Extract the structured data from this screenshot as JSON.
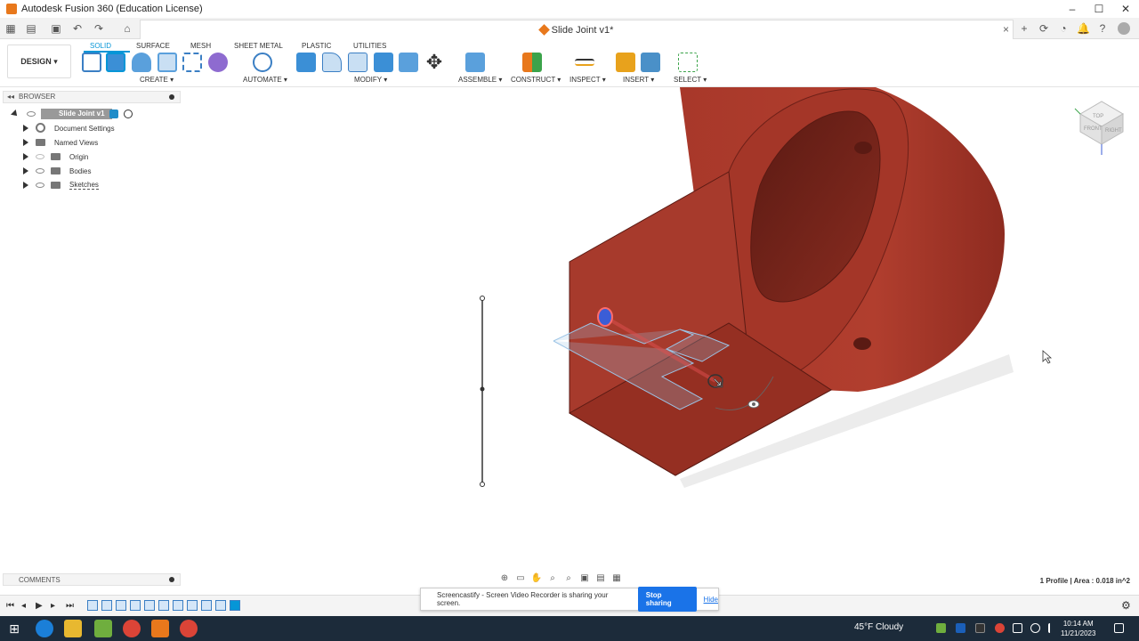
{
  "window": {
    "title": "Autodesk Fusion 360 (Education License)",
    "controls": [
      "–",
      "☐",
      "✕"
    ]
  },
  "document_tab": {
    "title": "Slide Joint v1*",
    "close": "×"
  },
  "ribbon": {
    "workspace": "DESIGN ▾",
    "tabs": [
      "SOLID",
      "SURFACE",
      "MESH",
      "SHEET METAL",
      "PLASTIC",
      "UTILITIES"
    ],
    "active_tab": "SOLID",
    "groups": [
      "CREATE ▾",
      "AUTOMATE ▾",
      "MODIFY ▾",
      "ASSEMBLE ▾",
      "CONSTRUCT ▾",
      "INSPECT ▾",
      "INSERT ▾",
      "SELECT ▾"
    ]
  },
  "browser": {
    "label": "BROWSER",
    "root": "Slide Joint v1",
    "items": [
      "Document Settings",
      "Named Views",
      "Origin",
      "Bodies",
      "Sketches"
    ]
  },
  "comments": {
    "label": "COMMENTS"
  },
  "status": {
    "text": "1 Profile | Area : 0.018 in^2"
  },
  "share_bar": {
    "message": "Screencastify - Screen Video Recorder is sharing your screen.",
    "stop_label": "Stop sharing",
    "hide_label": "Hide"
  },
  "taskbar": {
    "weather": "45°F  Cloudy",
    "time": "10:14 AM",
    "date": "11/21/2023"
  },
  "viewcube": {
    "faces": [
      "TOP",
      "FRONT",
      "RIGHT"
    ]
  },
  "colors": {
    "accent": "#0696d7",
    "body_face": "#a83a2c",
    "taskbar": "#1c2b3a",
    "share_button": "#1a73e8"
  }
}
